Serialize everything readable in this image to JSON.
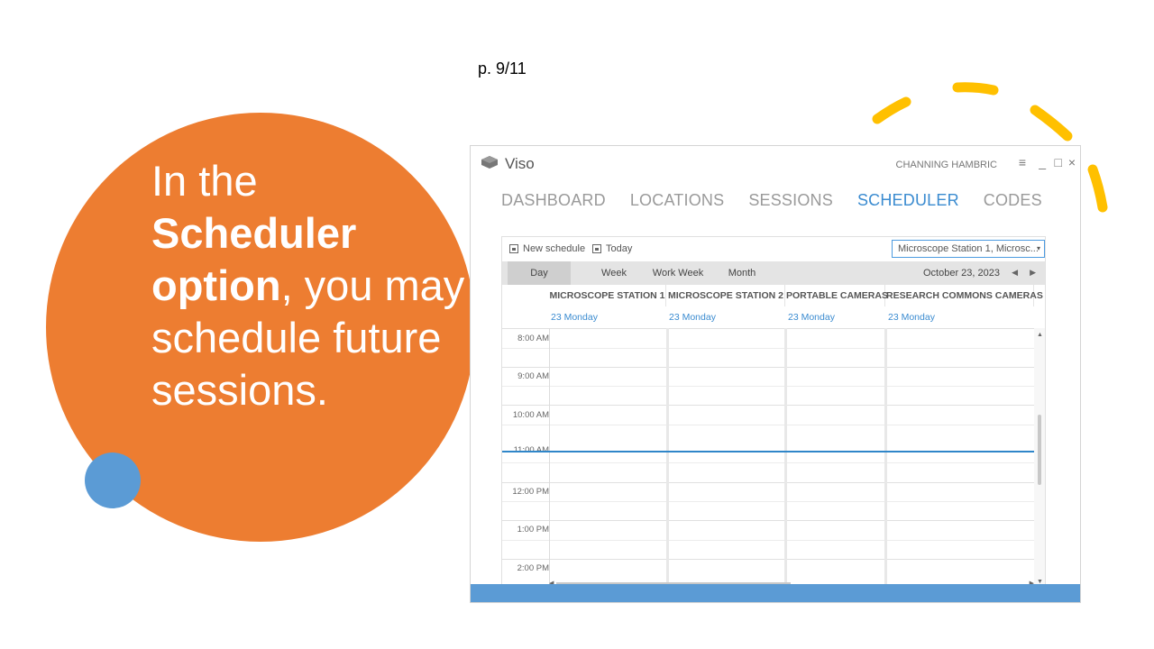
{
  "slide": {
    "page_number": "p. 9/11",
    "headline": {
      "part1": "In the",
      "bold1": "Scheduler option",
      "part2": ", you may schedule future sessions."
    },
    "colors": {
      "big_circle": "#ed7d31",
      "small_circle": "#5b9bd5",
      "deco_arc": "#ffc000"
    }
  },
  "app": {
    "name": "Viso",
    "user": "CHANNING HAMBRIC",
    "window_buttons": {
      "menu": "≡",
      "minimize": "_",
      "maximize": "□",
      "close": "×"
    },
    "nav": [
      "DASHBOARD",
      "LOCATIONS",
      "SESSIONS",
      "SCHEDULER",
      "CODES"
    ],
    "nav_active": "SCHEDULER",
    "toolbar": {
      "new_schedule": "New schedule",
      "today": "Today"
    },
    "resource_select": {
      "value": "Microscope Station 1, Microsc...",
      "arrow": "▾"
    },
    "views": [
      "Day",
      "Week",
      "Work Week",
      "Month"
    ],
    "active_view": "Day",
    "date": "October 23, 2023",
    "prev_arrow": "◀",
    "next_arrow": "▶",
    "columns": [
      "MICROSCOPE STATION 1",
      "MICROSCOPE STATION 2",
      "PORTABLE CAMERAS",
      "RESEARCH COMMONS CAMERAS"
    ],
    "day_label": "23 Monday",
    "times": [
      "8:00 AM",
      "9:00 AM",
      "10:00 AM",
      "11:00 AM",
      "12:00 PM",
      "1:00 PM",
      "2:00 PM"
    ],
    "accent_color": "#3a8bd0",
    "status_bar_color": "#5b9bd5"
  }
}
